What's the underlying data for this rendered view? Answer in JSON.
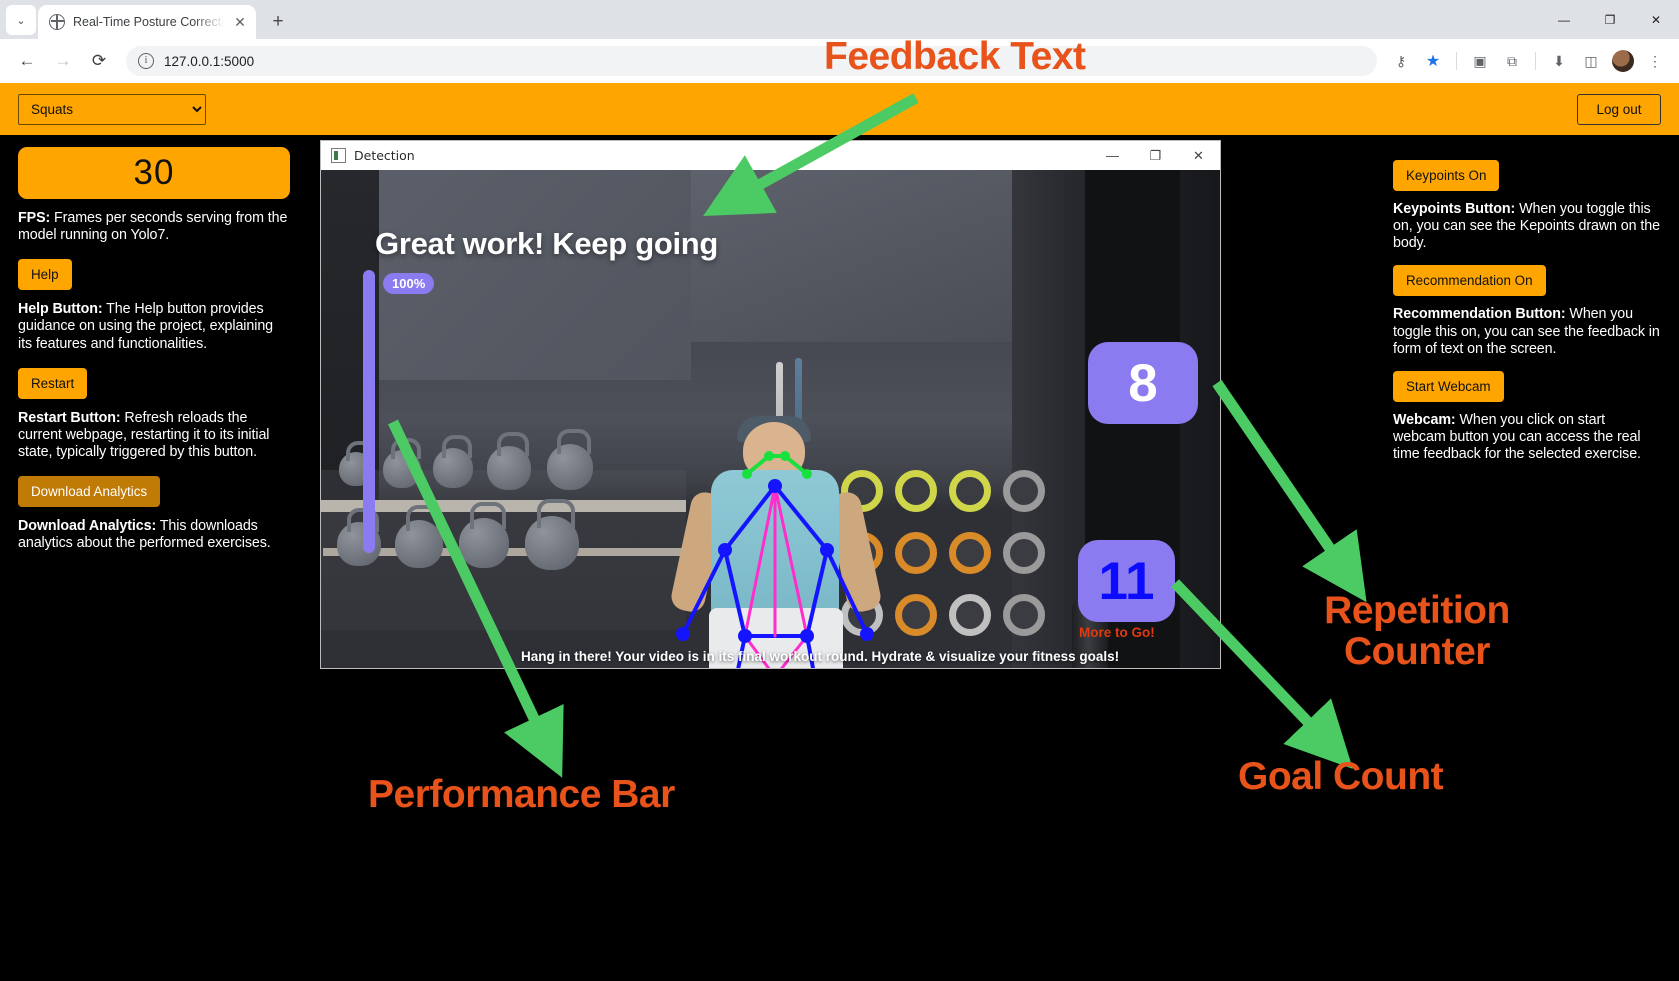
{
  "browser": {
    "tab_title": "Real-Time Posture Correction in",
    "tab_close": "✕",
    "new_tab": "+",
    "tab_list_chevron": "⌄",
    "back": "←",
    "forward": "→",
    "reload": "⟳",
    "site_info": "i",
    "url": "127.0.0.1:5000",
    "icons": {
      "password": "⚷",
      "star": "★",
      "cast": "▣",
      "extensions": "⧉",
      "download": "⬇",
      "sidepanel": "◫",
      "menu": "⋮"
    },
    "window_controls": {
      "minimize": "—",
      "maximize": "❐",
      "close": "✕"
    }
  },
  "app_bar": {
    "exercise_selected": "Squats",
    "exercise_options": [
      "Squats"
    ],
    "logout_label": "Log out"
  },
  "left_panel": {
    "fps_value": "30",
    "fps_desc_label": "FPS:",
    "fps_desc_text": " Frames per seconds serving from the model running on Yolo7.",
    "help_button": "Help",
    "help_desc_label": "Help Button:",
    "help_desc_text": " The Help button provides guidance on using the project, explaining its features and functionalities.",
    "restart_button": "Restart",
    "restart_desc_label": "Restart Button:",
    "restart_desc_text": " Refresh reloads the current webpage, restarting it to its initial state, typically triggered by this button.",
    "download_button": "Download Analytics",
    "download_desc_label": "Download Analytics:",
    "download_desc_text": " This downloads analytics about the performed exercises."
  },
  "right_panel": {
    "keypoints_button": "Keypoints On",
    "keypoints_desc_label": "Keypoints Button:",
    "keypoints_desc_text": " When you toggle this on, you can see the Kepoints drawn on the body.",
    "recommendation_button": "Recommendation On",
    "recommendation_desc_label": "Recommendation Button:",
    "recommendation_desc_text": " When you toggle this on, you can see the feedback in form of text on the screen.",
    "webcam_button": "Start Webcam",
    "webcam_desc_label": "Webcam:",
    "webcam_desc_text": " When you click on start webcam button you can access the real time feedback for the selected exercise."
  },
  "detection_window": {
    "title": "Detection",
    "feedback_text": "Great work! Keep going",
    "performance_percent": "100%",
    "repetition_count": "8",
    "goal_count": "11",
    "goal_subtext": "More to Go!",
    "caption": "Hang in there! Your video is in its final workout round. Hydrate & visualize your fitness goals!"
  },
  "annotations": {
    "feedback": "Feedback Text",
    "repetition": "Repetition Counter",
    "goal": "Goal Count",
    "performance": "Performance Bar"
  },
  "colors": {
    "accent_orange": "#FFA500",
    "annotation_orange": "#E8521B",
    "arrow_green": "#4CCB64",
    "badge_purple": "#8b7bf0",
    "goal_blue": "#0b0bff",
    "goal_sub_red": "#e03a10",
    "download_amber": "#c07a06"
  }
}
